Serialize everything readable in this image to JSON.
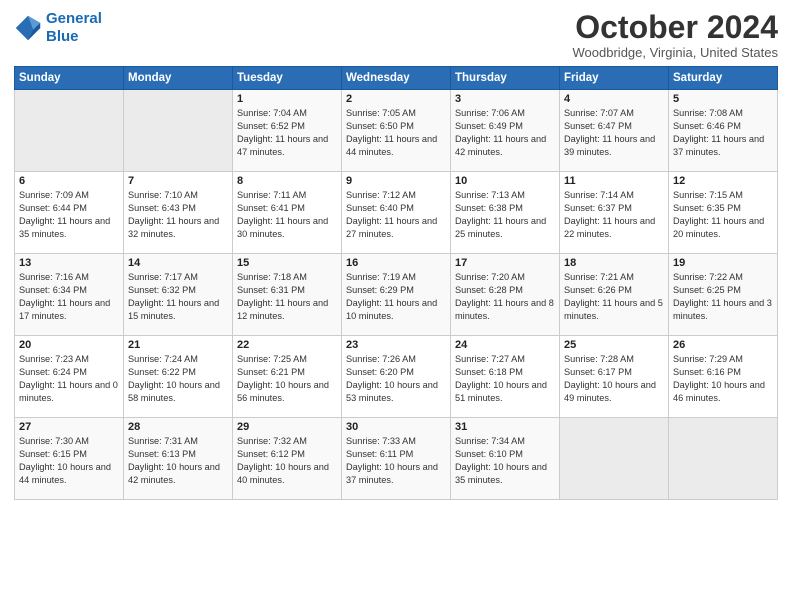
{
  "header": {
    "logo_line1": "General",
    "logo_line2": "Blue",
    "month": "October 2024",
    "location": "Woodbridge, Virginia, United States"
  },
  "days_of_week": [
    "Sunday",
    "Monday",
    "Tuesday",
    "Wednesday",
    "Thursday",
    "Friday",
    "Saturday"
  ],
  "weeks": [
    [
      {
        "day": "",
        "info": ""
      },
      {
        "day": "",
        "info": ""
      },
      {
        "day": "1",
        "info": "Sunrise: 7:04 AM\nSunset: 6:52 PM\nDaylight: 11 hours and 47 minutes."
      },
      {
        "day": "2",
        "info": "Sunrise: 7:05 AM\nSunset: 6:50 PM\nDaylight: 11 hours and 44 minutes."
      },
      {
        "day": "3",
        "info": "Sunrise: 7:06 AM\nSunset: 6:49 PM\nDaylight: 11 hours and 42 minutes."
      },
      {
        "day": "4",
        "info": "Sunrise: 7:07 AM\nSunset: 6:47 PM\nDaylight: 11 hours and 39 minutes."
      },
      {
        "day": "5",
        "info": "Sunrise: 7:08 AM\nSunset: 6:46 PM\nDaylight: 11 hours and 37 minutes."
      }
    ],
    [
      {
        "day": "6",
        "info": "Sunrise: 7:09 AM\nSunset: 6:44 PM\nDaylight: 11 hours and 35 minutes."
      },
      {
        "day": "7",
        "info": "Sunrise: 7:10 AM\nSunset: 6:43 PM\nDaylight: 11 hours and 32 minutes."
      },
      {
        "day": "8",
        "info": "Sunrise: 7:11 AM\nSunset: 6:41 PM\nDaylight: 11 hours and 30 minutes."
      },
      {
        "day": "9",
        "info": "Sunrise: 7:12 AM\nSunset: 6:40 PM\nDaylight: 11 hours and 27 minutes."
      },
      {
        "day": "10",
        "info": "Sunrise: 7:13 AM\nSunset: 6:38 PM\nDaylight: 11 hours and 25 minutes."
      },
      {
        "day": "11",
        "info": "Sunrise: 7:14 AM\nSunset: 6:37 PM\nDaylight: 11 hours and 22 minutes."
      },
      {
        "day": "12",
        "info": "Sunrise: 7:15 AM\nSunset: 6:35 PM\nDaylight: 11 hours and 20 minutes."
      }
    ],
    [
      {
        "day": "13",
        "info": "Sunrise: 7:16 AM\nSunset: 6:34 PM\nDaylight: 11 hours and 17 minutes."
      },
      {
        "day": "14",
        "info": "Sunrise: 7:17 AM\nSunset: 6:32 PM\nDaylight: 11 hours and 15 minutes."
      },
      {
        "day": "15",
        "info": "Sunrise: 7:18 AM\nSunset: 6:31 PM\nDaylight: 11 hours and 12 minutes."
      },
      {
        "day": "16",
        "info": "Sunrise: 7:19 AM\nSunset: 6:29 PM\nDaylight: 11 hours and 10 minutes."
      },
      {
        "day": "17",
        "info": "Sunrise: 7:20 AM\nSunset: 6:28 PM\nDaylight: 11 hours and 8 minutes."
      },
      {
        "day": "18",
        "info": "Sunrise: 7:21 AM\nSunset: 6:26 PM\nDaylight: 11 hours and 5 minutes."
      },
      {
        "day": "19",
        "info": "Sunrise: 7:22 AM\nSunset: 6:25 PM\nDaylight: 11 hours and 3 minutes."
      }
    ],
    [
      {
        "day": "20",
        "info": "Sunrise: 7:23 AM\nSunset: 6:24 PM\nDaylight: 11 hours and 0 minutes."
      },
      {
        "day": "21",
        "info": "Sunrise: 7:24 AM\nSunset: 6:22 PM\nDaylight: 10 hours and 58 minutes."
      },
      {
        "day": "22",
        "info": "Sunrise: 7:25 AM\nSunset: 6:21 PM\nDaylight: 10 hours and 56 minutes."
      },
      {
        "day": "23",
        "info": "Sunrise: 7:26 AM\nSunset: 6:20 PM\nDaylight: 10 hours and 53 minutes."
      },
      {
        "day": "24",
        "info": "Sunrise: 7:27 AM\nSunset: 6:18 PM\nDaylight: 10 hours and 51 minutes."
      },
      {
        "day": "25",
        "info": "Sunrise: 7:28 AM\nSunset: 6:17 PM\nDaylight: 10 hours and 49 minutes."
      },
      {
        "day": "26",
        "info": "Sunrise: 7:29 AM\nSunset: 6:16 PM\nDaylight: 10 hours and 46 minutes."
      }
    ],
    [
      {
        "day": "27",
        "info": "Sunrise: 7:30 AM\nSunset: 6:15 PM\nDaylight: 10 hours and 44 minutes."
      },
      {
        "day": "28",
        "info": "Sunrise: 7:31 AM\nSunset: 6:13 PM\nDaylight: 10 hours and 42 minutes."
      },
      {
        "day": "29",
        "info": "Sunrise: 7:32 AM\nSunset: 6:12 PM\nDaylight: 10 hours and 40 minutes."
      },
      {
        "day": "30",
        "info": "Sunrise: 7:33 AM\nSunset: 6:11 PM\nDaylight: 10 hours and 37 minutes."
      },
      {
        "day": "31",
        "info": "Sunrise: 7:34 AM\nSunset: 6:10 PM\nDaylight: 10 hours and 35 minutes."
      },
      {
        "day": "",
        "info": ""
      },
      {
        "day": "",
        "info": ""
      }
    ]
  ]
}
